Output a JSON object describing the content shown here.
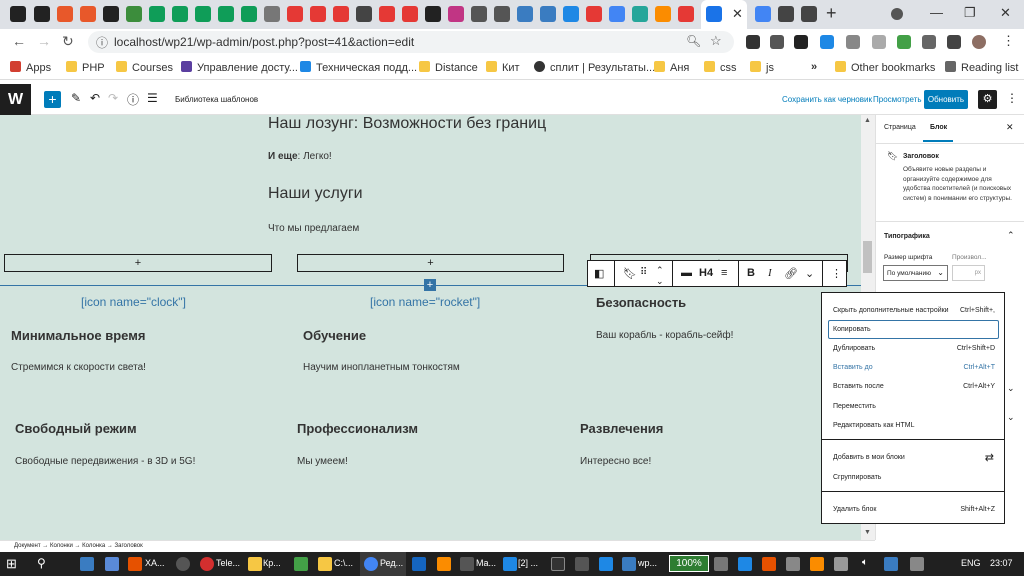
{
  "browser": {
    "url": "localhost/wp21/wp-admin/post.php?post=41&action=edit",
    "bookmarks": [
      "Apps",
      "PHP",
      "Courses",
      "Управление досту...",
      "Техническая подд...",
      "Distance",
      "Кит",
      "сплит | Результаты...",
      "Аня",
      "css",
      "js"
    ],
    "bookmarks_more": "»",
    "other_bookmarks": "Other bookmarks",
    "reading_list": "Reading list"
  },
  "wp": {
    "template_library": "Библиотека шаблонов",
    "save_draft": "Сохранить как черновик",
    "preview": "Просмотреть",
    "publish": "Обновить",
    "logo": "W"
  },
  "canvas": {
    "slogan": "Наш лозунг: Возможности без границ",
    "also_label": "И еще",
    "also_text": ": Легко!",
    "services_heading": "Наши услуги",
    "services_sub": "Что мы предлагаем",
    "plus": "+",
    "col1": {
      "icon": "[icon name=\"clock\"]",
      "title": "Минимальное время",
      "text": "Стремимся к скорости света!"
    },
    "col2": {
      "icon": "[icon name=\"rocket\"]",
      "title": "Обучение",
      "text": "Научим инопланетным тонкостям"
    },
    "col3": {
      "title": "Безопасность",
      "text": "Ваш корабль - корабль-сейф!"
    },
    "row2": [
      {
        "title": "Свободный режим",
        "text": "Свободные передвижения - в 3D и 5G!"
      },
      {
        "title": "Профессионализм",
        "text": "Мы умеем!"
      },
      {
        "title": "Развлечения",
        "text": "Интересно все!"
      }
    ]
  },
  "block_toolbar": {
    "heading_level": "H4",
    "bold": "B",
    "italic": "I"
  },
  "sidebar": {
    "tab_page": "Страница",
    "tab_block": "Блок",
    "block_name": "Заголовок",
    "block_desc": "Объявите новые разделы и организуйте содержимое для удобства посетителей (и поисковых систем) в понимании его структуры.",
    "typography": "Типографика",
    "font_size_label": "Размер шрифта",
    "custom_label": "Произвол...",
    "font_size_value": "По умолчанию",
    "custom_unit": "px"
  },
  "menu": {
    "items": [
      {
        "label": "Скрыть дополнительные настройки",
        "shortcut": "Ctrl+Shift+,"
      },
      {
        "label": "Копировать",
        "shortcut": ""
      },
      {
        "label": "Дублировать",
        "shortcut": "Ctrl+Shift+D"
      },
      {
        "label": "Вставить до",
        "shortcut": "Ctrl+Alt+T"
      },
      {
        "label": "Вставить после",
        "shortcut": "Ctrl+Alt+Y"
      },
      {
        "label": "Переместить",
        "shortcut": ""
      },
      {
        "label": "Редактировать как HTML",
        "shortcut": ""
      },
      {
        "label": "Добавить в мои блоки",
        "shortcut": ""
      },
      {
        "label": "Сгруппировать",
        "shortcut": ""
      },
      {
        "label": "Удалить блок",
        "shortcut": "Shift+Alt+Z"
      }
    ]
  },
  "breadcrumb": "Документ → Колонки → Колонка → Заголовок",
  "taskbar": {
    "items": [
      "XA...",
      "Tele...",
      "Кр...",
      "C:\\...",
      "Ред...",
      "Ma...",
      "[2] ...",
      "wp..."
    ],
    "battery": "100%",
    "lang": "ENG",
    "time": "23:07"
  }
}
